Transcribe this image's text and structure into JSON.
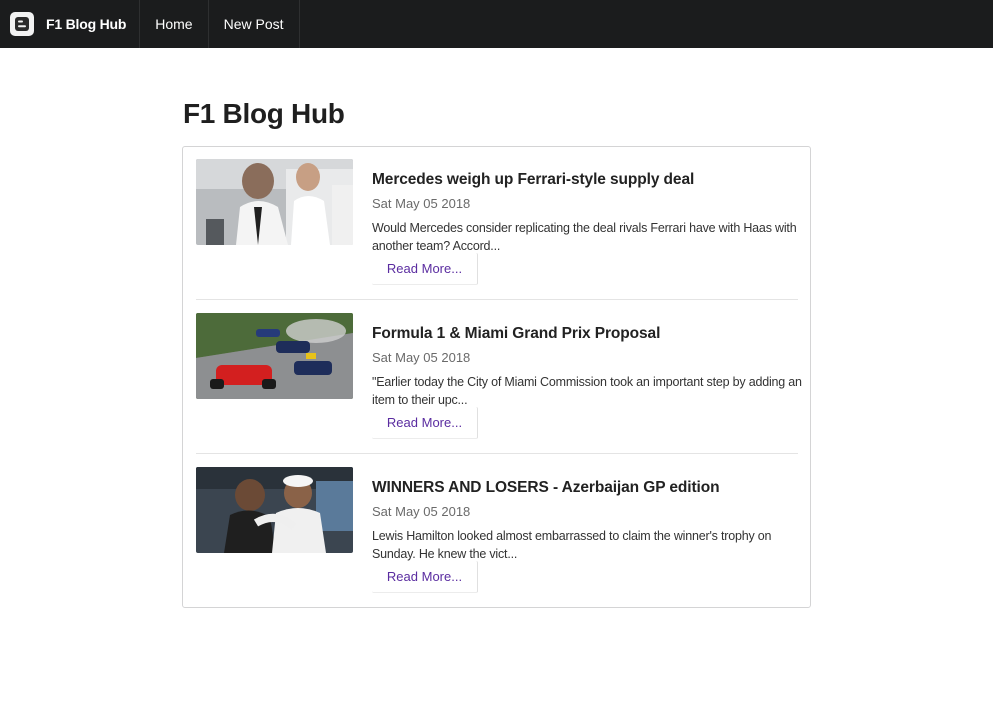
{
  "navbar": {
    "brand": "F1 Blog Hub",
    "brand_icon": "blogger-icon",
    "items": [
      {
        "label": "Home"
      },
      {
        "label": "New Post"
      }
    ]
  },
  "page": {
    "title": "F1 Blog Hub"
  },
  "posts": [
    {
      "title": "Mercedes weigh up Ferrari-style supply deal",
      "date": "Sat May 05 2018",
      "excerpt": "Would Mercedes consider replicating the deal rivals Ferrari have with Haas with another team? Accord...",
      "read_more": "Read More..."
    },
    {
      "title": "Formula 1 & Miami Grand Prix Proposal",
      "date": "Sat May 05 2018",
      "excerpt": "\"Earlier today the City of Miami Commission took an important step by adding an item to their upc...",
      "read_more": "Read More..."
    },
    {
      "title": "WINNERS AND LOSERS - Azerbaijan GP edition",
      "date": "Sat May 05 2018",
      "excerpt": "Lewis Hamilton looked almost embarrassed to claim the winner's trophy on Sunday. He knew the vict...",
      "read_more": "Read More..."
    }
  ],
  "colors": {
    "navbar_bg": "#1b1c1d",
    "link": "#5a2ca0",
    "card_border": "#d4d4d5"
  }
}
